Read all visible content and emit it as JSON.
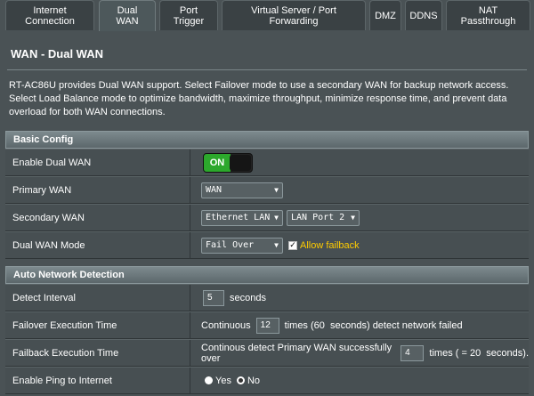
{
  "tabs": [
    {
      "label": "Internet\nConnection",
      "active": false
    },
    {
      "label": "Dual\nWAN",
      "active": true
    },
    {
      "label": "Port\nTrigger",
      "active": false
    },
    {
      "label": "Virtual Server / Port\nForwarding",
      "active": false
    },
    {
      "label": "DMZ",
      "active": false
    },
    {
      "label": "DDNS",
      "active": false
    },
    {
      "label": "NAT\nPassthrough",
      "active": false
    }
  ],
  "page": {
    "title": "WAN - Dual WAN",
    "description": "RT-AC86U provides Dual WAN support. Select Failover mode to use a secondary WAN for backup network access. Select Load Balance mode to optimize bandwidth, maximize throughput, minimize response time, and prevent data overload for both WAN connections."
  },
  "basic_config": {
    "header": "Basic Config",
    "enable_dual_wan": {
      "label": "Enable Dual WAN",
      "state": "ON"
    },
    "primary_wan": {
      "label": "Primary WAN",
      "value": "WAN"
    },
    "secondary_wan": {
      "label": "Secondary WAN",
      "value": "Ethernet LAN",
      "port": "LAN Port 2"
    },
    "dual_wan_mode": {
      "label": "Dual WAN Mode",
      "value": "Fail Over",
      "allow_failback": "Allow failback"
    }
  },
  "auto_detect": {
    "header": "Auto Network Detection",
    "detect_interval": {
      "label": "Detect Interval",
      "value": "5",
      "unit": "seconds"
    },
    "failover": {
      "label": "Failover Execution Time",
      "prefix": "Continuous",
      "value": "12",
      "suffix": "times (60  seconds) detect network failed"
    },
    "failback": {
      "label": "Failback Execution Time",
      "prefix": "Continous detect Primary WAN successfully over",
      "value": "4",
      "suffix": "times ( = 20  seconds)."
    },
    "ping": {
      "label": "Enable Ping to Internet",
      "yes": "Yes",
      "no": "No"
    }
  },
  "colors": {
    "accent_on": "#2ca82c",
    "highlight": "#ffcc00",
    "background": "#4a5255"
  }
}
